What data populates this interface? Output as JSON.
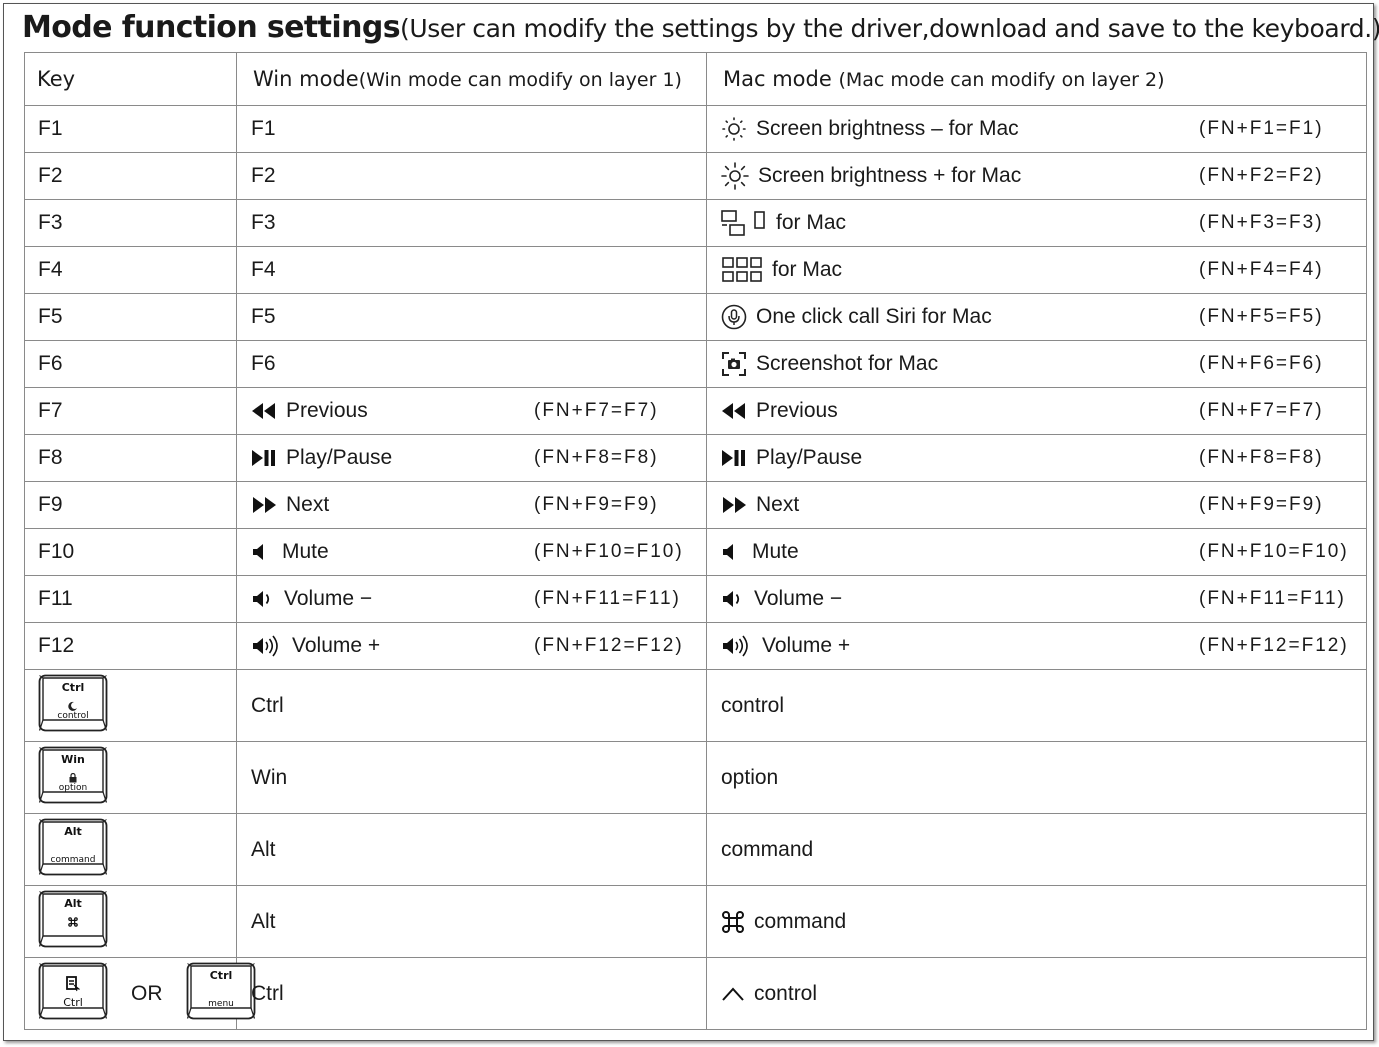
{
  "heading": {
    "title": "Mode function settings",
    "subtitle": "(User can modify the settings by the driver,download and save to the keyboard.)"
  },
  "columns": {
    "key": "Key",
    "win": "Win mode",
    "win_note": "(Win mode can modify on layer 1)",
    "mac": "Mac mode",
    "mac_note": "(Mac mode can modify on layer 2)"
  },
  "fn_rows": [
    {
      "key": "F1",
      "win": "F1",
      "win_combo": "",
      "mac_icon": "brightness-down-icon",
      "mac": "Screen brightness – for Mac",
      "mac_combo": "(FN+F1=F1)"
    },
    {
      "key": "F2",
      "win": "F2",
      "win_combo": "",
      "mac_icon": "brightness-up-icon",
      "mac": "Screen brightness + for Mac",
      "mac_combo": "(FN+F2=F2)"
    },
    {
      "key": "F3",
      "win": "F3",
      "win_combo": "",
      "mac_icon": "mission-control-icon",
      "mac": "for Mac",
      "mac_combo": "(FN+F3=F3)"
    },
    {
      "key": "F4",
      "win": "F4",
      "win_combo": "",
      "mac_icon": "launchpad-icon",
      "mac": "for Mac",
      "mac_combo": "(FN+F4=F4)"
    },
    {
      "key": "F5",
      "win": "F5",
      "win_combo": "",
      "mac_icon": "siri-microphone-icon",
      "mac": "One click call Siri for Mac",
      "mac_combo": "(FN+F5=F5)"
    },
    {
      "key": "F6",
      "win": "F6",
      "win_combo": "",
      "mac_icon": "screenshot-icon",
      "mac": "Screenshot for Mac",
      "mac_combo": "(FN+F6=F6)"
    },
    {
      "key": "F7",
      "win_icon": "previous-icon",
      "win": "Previous",
      "win_combo": "(FN+F7=F7)",
      "mac_icon": "previous-icon",
      "mac": "Previous",
      "mac_combo": "(FN+F7=F7)"
    },
    {
      "key": "F8",
      "win_icon": "play-pause-icon",
      "win": "Play/Pause",
      "win_combo": "(FN+F8=F8)",
      "mac_icon": "play-pause-icon",
      "mac": "Play/Pause",
      "mac_combo": "(FN+F8=F8)"
    },
    {
      "key": "F9",
      "win_icon": "next-icon",
      "win": "Next",
      "win_combo": "(FN+F9=F9)",
      "mac_icon": "next-icon",
      "mac": "Next",
      "mac_combo": "(FN+F9=F9)"
    },
    {
      "key": "F10",
      "win_icon": "mute-icon",
      "win": "Mute",
      "win_combo": "(FN+F10=F10)",
      "mac_icon": "mute-icon",
      "mac": "Mute",
      "mac_combo": "(FN+F10=F10)"
    },
    {
      "key": "F11",
      "win_icon": "volume-down-icon",
      "win": "Volume −",
      "win_combo": "(FN+F11=F11)",
      "mac_icon": "volume-down-icon",
      "mac": "Volume −",
      "mac_combo": "(FN+F11=F11)"
    },
    {
      "key": "F12",
      "win_icon": "volume-up-icon",
      "win": "Volume +",
      "win_combo": "(FN+F12=F12)",
      "mac_icon": "volume-up-icon",
      "mac": "Volume +",
      "mac_combo": "(FN+F12=F12)"
    }
  ],
  "key_rows": [
    {
      "keycaps": [
        {
          "top": "Ctrl",
          "icon": "moon-icon",
          "bottom": "control"
        }
      ],
      "win": "Ctrl",
      "mac": "control",
      "mac_icon": ""
    },
    {
      "keycaps": [
        {
          "top": "Win",
          "icon": "lock-icon",
          "bottom": "option"
        }
      ],
      "win": "Win",
      "mac": "option",
      "mac_icon": ""
    },
    {
      "keycaps": [
        {
          "top": "Alt",
          "icon": "",
          "bottom": "command"
        }
      ],
      "win": "Alt",
      "mac": "command",
      "mac_icon": ""
    },
    {
      "keycaps": [
        {
          "top": "Alt",
          "icon": "command-icon",
          "bottom": ""
        }
      ],
      "win": "Alt",
      "mac": "command",
      "mac_icon": "command-icon"
    },
    {
      "keycaps": [
        {
          "top": "",
          "icon": "context-menu-icon",
          "bottom": "Ctrl"
        },
        {
          "top": "Ctrl",
          "icon": "",
          "bottom": "menu"
        }
      ],
      "or_text": "OR",
      "win": "Ctrl",
      "mac": "control",
      "mac_icon": "caret-control-icon"
    }
  ]
}
